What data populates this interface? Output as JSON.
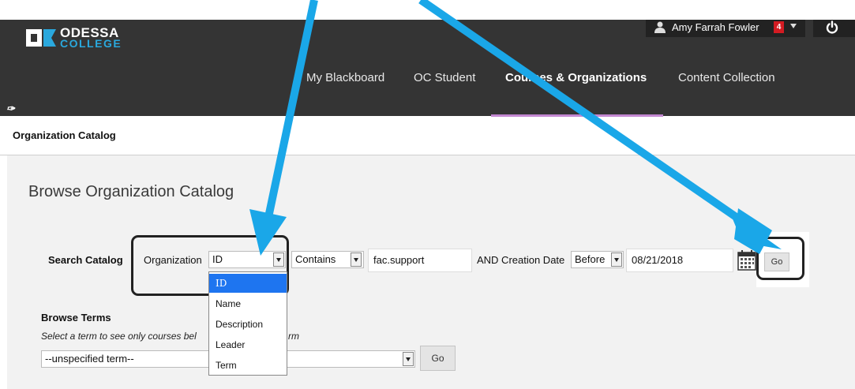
{
  "brand": {
    "logo_line1": "ODESSA",
    "logo_line2": "COLLEGE",
    "accent": "#2aa8dd"
  },
  "user": {
    "name": "Amy Farrah Fowler",
    "notification_count": "4"
  },
  "nav": {
    "items": [
      {
        "label": "My Blackboard",
        "active": false
      },
      {
        "label": "OC Student",
        "active": false
      },
      {
        "label": "Courses & Organizations",
        "active": true
      },
      {
        "label": "Content Collection",
        "active": false
      }
    ],
    "edit_glyph": "𝘀"
  },
  "breadcrumb": {
    "label": "Organization Catalog"
  },
  "page": {
    "title": "Browse Organization Catalog"
  },
  "search": {
    "label": "Search Catalog",
    "field_label": "Organization",
    "field_value": "ID",
    "field_options": [
      "ID",
      "Name",
      "Description",
      "Leader",
      "Term"
    ],
    "operator": "Contains",
    "query": "fac.support",
    "date_label": "AND Creation Date",
    "date_operator": "Before",
    "date_value": "08/21/2018",
    "go_label": "Go"
  },
  "browse_terms": {
    "heading": "Browse Terms",
    "hint_before": "Select a term to see only courses bel",
    "hint_after": "rm",
    "term_value": "--unspecified term--",
    "go_label": "Go"
  },
  "annotation_color": "#1aa7e8"
}
